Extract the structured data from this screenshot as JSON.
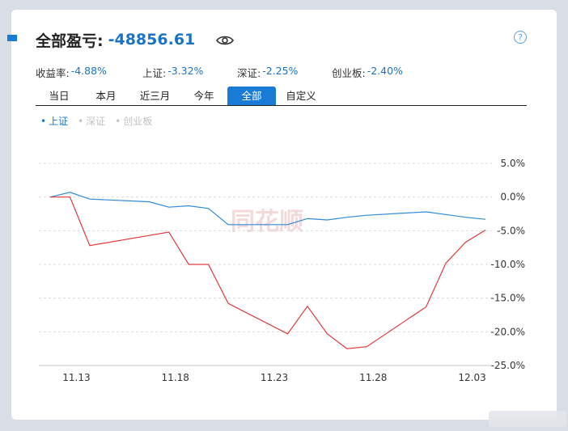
{
  "header": {
    "title_label": "全部盈亏:",
    "title_value": "-48856.61",
    "help_text": "?"
  },
  "stats": [
    {
      "label": "收益率:",
      "value": "-4.88%"
    },
    {
      "label": "上证:",
      "value": "-3.32%"
    },
    {
      "label": "深证:",
      "value": "-2.25%"
    },
    {
      "label": "创业板:",
      "value": "-2.40%"
    }
  ],
  "tabs": [
    {
      "label": "当日"
    },
    {
      "label": "本月"
    },
    {
      "label": "近三月"
    },
    {
      "label": "今年"
    },
    {
      "label": "全部",
      "active": true
    },
    {
      "label": "自定义"
    }
  ],
  "legend": [
    {
      "label": "上证",
      "active": true
    },
    {
      "label": "深证",
      "active": false
    },
    {
      "label": "创业板",
      "active": false
    }
  ],
  "watermark": "同花顺",
  "colors": {
    "accent": "#1a7bd6",
    "portfolio_line": "#e0393e",
    "index_line": "#2f8ad8"
  },
  "chart_data": {
    "type": "line",
    "x_ticks": [
      "11.13",
      "11.18",
      "11.23",
      "11.28",
      "12.03"
    ],
    "y_ticks": [
      "5.0%",
      "0.0%",
      "-5.0%",
      "-10.0%",
      "-15.0%",
      "-20.0%",
      "-25.0%"
    ],
    "ylim": [
      -25,
      5
    ],
    "x_dates": [
      "11.12",
      "11.13",
      "11.14",
      "11.17",
      "11.18",
      "11.19",
      "11.20",
      "11.21",
      "11.24",
      "11.25",
      "11.26",
      "11.27",
      "11.28",
      "12.01",
      "12.02",
      "12.03",
      "12.04"
    ],
    "series": [
      {
        "values": [
          0.0,
          0.0,
          -7.2,
          -5.7,
          -5.2,
          -10.0,
          -10.0,
          -15.8,
          -20.3,
          -16.2,
          -20.3,
          -22.5,
          -22.2,
          -16.3,
          -9.8,
          -6.7,
          -4.9
        ]
      },
      {
        "values": [
          0.0,
          0.7,
          -0.3,
          -0.7,
          -1.5,
          -1.3,
          -1.7,
          -4.1,
          -4.1,
          -3.2,
          -3.4,
          -3.0,
          -2.7,
          -2.2,
          -2.6,
          -3.0,
          -3.3
        ]
      }
    ]
  }
}
